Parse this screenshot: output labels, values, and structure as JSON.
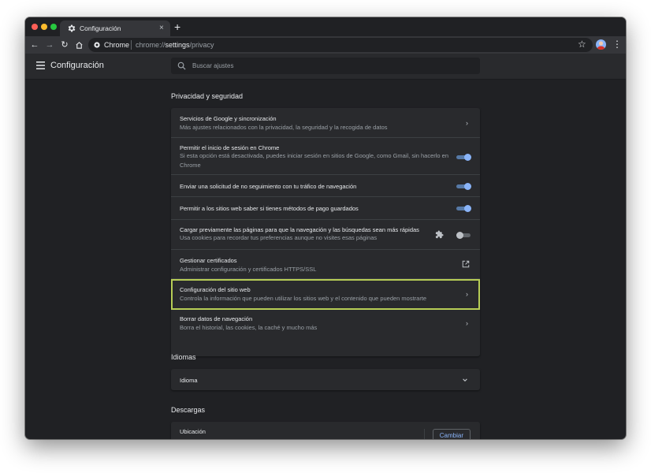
{
  "browser": {
    "tab_title": "Configuración",
    "new_tab_symbol": "+",
    "close_tab_symbol": "×",
    "site_name": "Chrome",
    "url_scheme": "chrome://",
    "url_host": "settings",
    "url_path": "/privacy"
  },
  "settings_header": {
    "title": "Configuración",
    "search_placeholder": "Buscar ajustes"
  },
  "privacy": {
    "section_title": "Privacidad y seguridad",
    "rows": [
      {
        "title": "Servicios de Google y sincronización",
        "subtitle": "Más ajustes relacionados con la privacidad, la seguridad y la recogida de datos",
        "control": "arrow"
      },
      {
        "title": "Permitir el inicio de sesión en Chrome",
        "subtitle": "Si esta opción está desactivada, puedes iniciar sesión en sitios de Google, como Gmail, sin hacerlo en Chrome",
        "control": "toggle",
        "on": true
      },
      {
        "title": "Enviar una solicitud de no seguimiento con tu tráfico de navegación",
        "subtitle": "",
        "control": "toggle",
        "on": true
      },
      {
        "title": "Permitir a los sitios web saber si tienes métodos de pago guardados",
        "subtitle": "",
        "control": "toggle",
        "on": true
      },
      {
        "title": "Cargar previamente las páginas para que la navegación y las búsquedas sean más rápidas",
        "subtitle": "Usa cookies para recordar tus preferencias aunque no visites esas páginas",
        "control": "toggle",
        "on": false
      },
      {
        "title": "Gestionar certificados",
        "subtitle": "Administrar configuración y certificados HTTPS/SSL",
        "control": "external"
      },
      {
        "title": "Configuración del sitio web",
        "subtitle": "Controla la información que pueden utilizar los sitios web y el contenido que pueden mostrarte",
        "control": "arrow"
      },
      {
        "title": "Borrar datos de navegación",
        "subtitle": "Borra el historial, las cookies, la caché y mucho más",
        "control": "arrow"
      }
    ]
  },
  "languages": {
    "section_title": "Idiomas",
    "row_title": "Idioma"
  },
  "downloads": {
    "section_title": "Descargas",
    "row_title": "Ubicación",
    "change_button": "Cambiar"
  },
  "colors": {
    "accent": "#8ab4f8",
    "highlight": "#b7cd56",
    "background": "#202124",
    "card": "#292a2d"
  }
}
